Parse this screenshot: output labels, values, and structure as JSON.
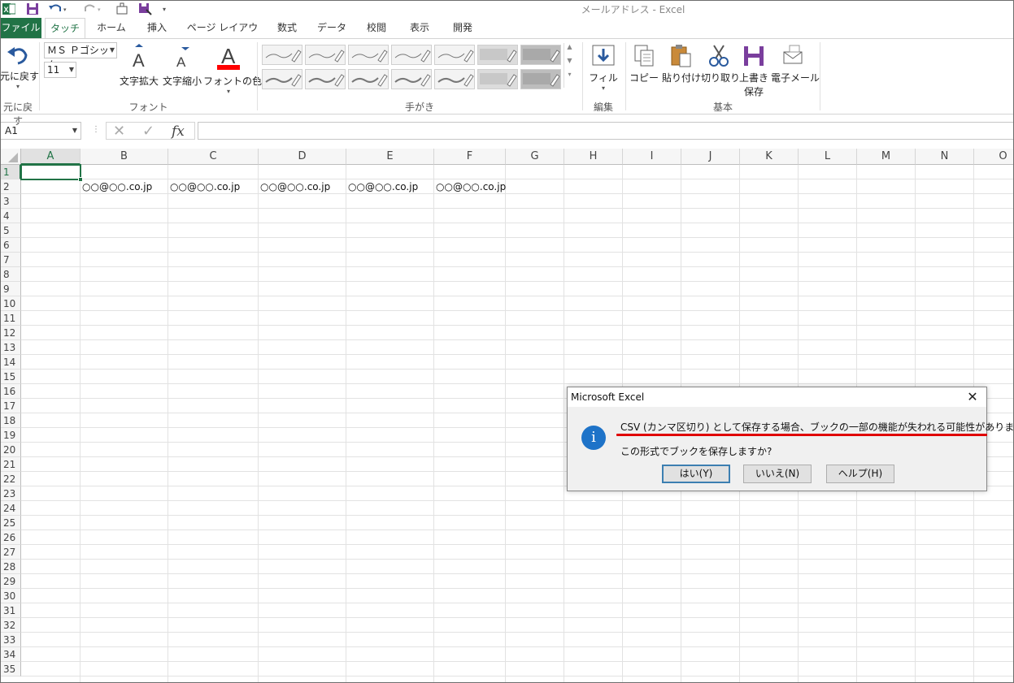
{
  "window": {
    "title": "メールアドレス - Excel"
  },
  "tabs": [
    "ファイル",
    "タッチ",
    "ホーム",
    "挿入",
    "ページ レイアウト",
    "数式",
    "データ",
    "校閲",
    "表示",
    "開発"
  ],
  "ribbon": {
    "undo_label": "元に戻す",
    "undo_group": "元に戻す",
    "font_name": "ＭＳ Ｐゴシック",
    "font_size": "11",
    "grow_font": "文字拡大",
    "shrink_font": "文字縮小",
    "font_color": "フォントの色",
    "font_group": "フォント",
    "ink_group": "手がき",
    "fill_label": "フィル",
    "edit_group": "編集",
    "copy_label": "コピー",
    "paste_label": "貼り付け",
    "cut_label": "切り取り",
    "save_label_1": "上書き",
    "save_label_2": "保存",
    "email_label": "電子メール",
    "basic_group": "基本",
    "accent": "#217346",
    "font_color_swatch": "#ff0000"
  },
  "formula_bar": {
    "name_box": "A1",
    "fx": "fx",
    "cancel": "✕",
    "enter": "✓"
  },
  "grid": {
    "columns": [
      "A",
      "B",
      "C",
      "D",
      "E",
      "F",
      "G",
      "H",
      "I",
      "J",
      "K",
      "L",
      "M",
      "N",
      "O"
    ],
    "rows": [
      "1",
      "2",
      "3",
      "4",
      "5",
      "6",
      "7",
      "8",
      "9",
      "10",
      "11",
      "12",
      "13",
      "14",
      "15",
      "16",
      "17",
      "18",
      "19",
      "20",
      "21",
      "22",
      "23",
      "24",
      "25",
      "26",
      "27",
      "28",
      "29",
      "30",
      "31",
      "32",
      "33",
      "34",
      "35"
    ],
    "row2_cells": [
      "○○@○○.co.jp",
      "○○@○○.co.jp",
      "○○@○○.co.jp",
      "○○@○○.co.jp",
      "○○@○○.co.jp"
    ]
  },
  "dialog": {
    "title": "Microsoft Excel",
    "close": "✕",
    "icon": "i",
    "message": "CSV (カンマ区切り) として保存する場合、ブックの一部の機能が失われる可能性があります。",
    "question": "この形式でブックを保存しますか?",
    "buttons": [
      "はい(Y)",
      "いいえ(N)",
      "ヘルプ(H)"
    ],
    "underline_color": "#e00000",
    "icon_color": "#1e73c8"
  }
}
